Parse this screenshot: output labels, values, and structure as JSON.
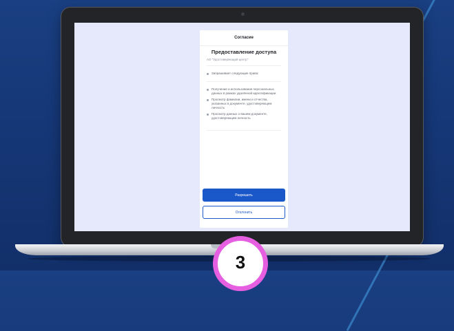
{
  "consent_screen": {
    "header": "Согласие",
    "title": "Предоставление доступа",
    "organization": "АО \"Удостоверяющий центр\"",
    "request_intro": "Запрашивает следующие права:",
    "permissions": [
      "Получение и использование персональных данных в рамках удалённой идентификации",
      "Просмотр фамилии, имени и отчества, указанных в документе, удостоверяющем личность",
      "Просмотр данных о вашем документе, удостоверяющем личность"
    ],
    "allow_button": "Разрешить",
    "decline_button": "Отклонить"
  },
  "step_badge": {
    "number": "3"
  },
  "colors": {
    "background": "#163878",
    "screen": "#e6e9fb",
    "primary_button": "#1a57c9",
    "badge_ring": "#e55fe0"
  }
}
